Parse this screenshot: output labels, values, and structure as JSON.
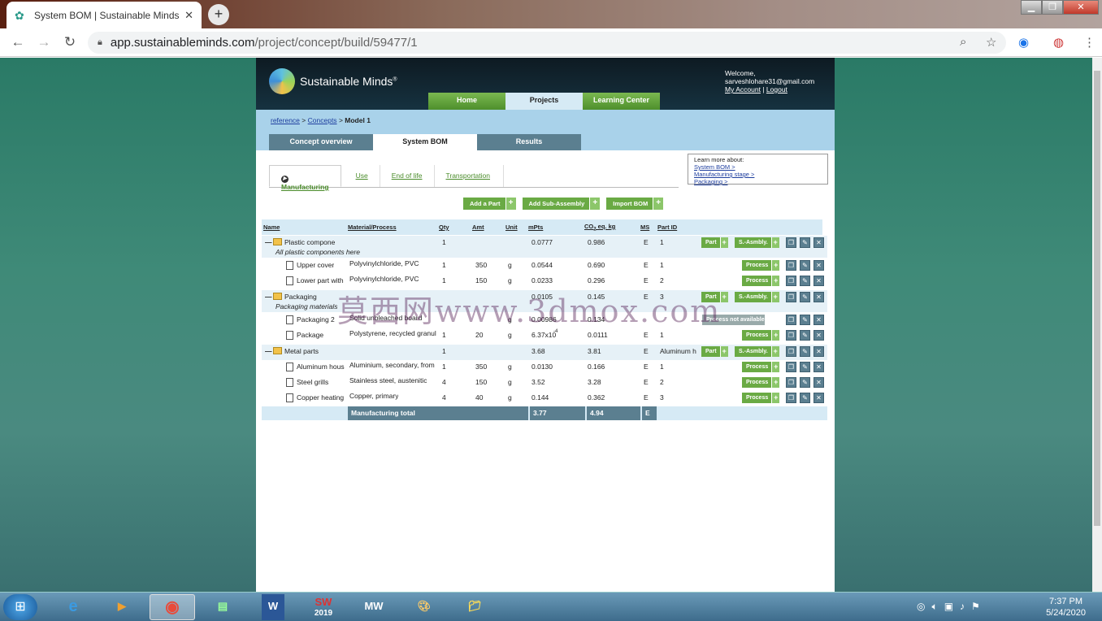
{
  "browser": {
    "tab_title": "System BOM | Sustainable Minds",
    "url_host": "app.sustainableminds.com",
    "url_path": "/project/concept/build/59477/1"
  },
  "site": {
    "logo_text": "Sustainable Minds",
    "logo_reg": "®",
    "welcome": "Welcome,",
    "user_email": "sarveshlohare31@gmail.com",
    "my_account": "My Account",
    "separator": "|",
    "logout": "Logout",
    "nav": [
      "Home",
      "Projects",
      "Learning Center"
    ]
  },
  "breadcrumb": {
    "crumb1": "reference",
    "sep1": ">",
    "crumb2": "Concepts",
    "sep2": ">",
    "current": "Model 1"
  },
  "subtabs": [
    "Concept overview",
    "System BOM",
    "Results"
  ],
  "stages": [
    "Manufacturing",
    "Use",
    "End of life",
    "Transportation"
  ],
  "learn": {
    "title": "Learn more about:",
    "links": [
      "System BOM >",
      "Manufacturing stage >",
      "Packaging >"
    ]
  },
  "actions": [
    "Add a Part",
    "Add Sub-Assembly",
    "Import BOM"
  ],
  "table": {
    "headers": [
      "Name",
      "Material/Process",
      "Qty",
      "Amt",
      "Unit",
      "mPts",
      "CO2 eq. kg",
      "MS",
      "Part ID"
    ],
    "co2_label": "CO",
    "co2_sub": "2",
    "co2_rest": " eq. kg",
    "part_btn": "Part",
    "sasm_btn": "S.-Asmbly.",
    "process_btn": "Process",
    "rows": [
      {
        "name": "Plastic components",
        "note": "All plastic components here",
        "material": "",
        "qty": "1",
        "amt": "",
        "unit": "",
        "mpts": "0.0777",
        "co2": "0.986",
        "ms": "E",
        "pid": "1"
      },
      {
        "name": "Upper cover",
        "material": "Polyvinylchloride, PVC",
        "qty": "1",
        "amt": "350",
        "unit": "g",
        "mpts": "0.0544",
        "co2": "0.690",
        "ms": "E",
        "pid": "1"
      },
      {
        "name": "Lower part with",
        "material": "Polyvinylchloride, PVC",
        "qty": "1",
        "amt": "150",
        "unit": "g",
        "mpts": "0.0233",
        "co2": "0.296",
        "ms": "E",
        "pid": "2"
      },
      {
        "name": "Packaging",
        "note": "Packaging materials",
        "material": "",
        "qty": "",
        "amt": "",
        "unit": "",
        "mpts": "0.0105",
        "co2": "0.145",
        "ms": "E",
        "pid": "3"
      },
      {
        "name": "Packaging 2",
        "material": "Solid unbleached board",
        "qty": "",
        "amt": "",
        "unit": "g",
        "mpts": "0.00986",
        "co2": "0.134",
        "ms": "",
        "pid": ""
      },
      {
        "name": "Package",
        "material": "Polystyrene, recycled granul",
        "qty": "1",
        "amt": "20",
        "unit": "g",
        "mpts": "6.37x10",
        "mpts_exp": "-4",
        "co2": "0.0111",
        "ms": "E",
        "pid": "1"
      },
      {
        "name": "Metal parts",
        "material": "",
        "qty": "1",
        "amt": "",
        "unit": "",
        "mpts": "3.68",
        "co2": "3.81",
        "ms": "E",
        "pid": "Aluminum h"
      },
      {
        "name": "Aluminum hous",
        "material": "Aluminium, secondary, from",
        "qty": "1",
        "amt": "350",
        "unit": "g",
        "mpts": "0.0130",
        "co2": "0.166",
        "ms": "E",
        "pid": "1"
      },
      {
        "name": "Steel grills",
        "material": "Stainless steel, austenitic",
        "qty": "4",
        "amt": "150",
        "unit": "g",
        "mpts": "3.52",
        "co2": "3.28",
        "ms": "E",
        "pid": "2"
      },
      {
        "name": "Copper heating",
        "material": "Copper, primary",
        "qty": "4",
        "amt": "40",
        "unit": "g",
        "mpts": "0.144",
        "co2": "0.362",
        "ms": "E",
        "pid": "3"
      }
    ],
    "disabled_btn": "Process not available",
    "total_label": "Manufacturing total",
    "total_mpts": "3.77",
    "total_co2": "4.94",
    "total_ms": "E"
  },
  "watermark": "莫西网www.3dmox.com",
  "taskbar": {
    "time": "7:37 PM",
    "date": "5/24/2020",
    "sw_label": "SW",
    "sw_year": "2019",
    "mw_label": "MW"
  }
}
